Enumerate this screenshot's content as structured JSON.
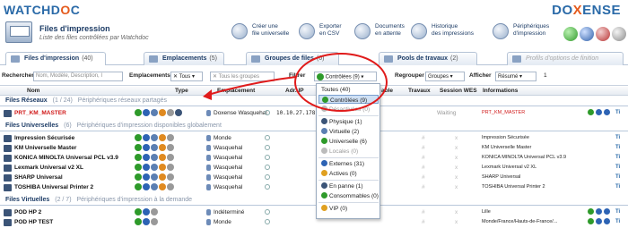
{
  "brand": {
    "left_prefix": "WATCHD",
    "left_mid": "O",
    "left_suffix": "C",
    "right_prefix": "DO",
    "right_mid": "X",
    "right_suffix": "ENSE"
  },
  "header": {
    "title": "Files d'impression",
    "subtitle": "Liste des files contrôlées par Watchdoc",
    "buttons": [
      {
        "line1": "Créer une",
        "line2": "file universelle"
      },
      {
        "line1": "Exporter",
        "line2": "en CSV"
      },
      {
        "line1": "Documents",
        "line2": "en attente"
      },
      {
        "line1": "Historique",
        "line2": "des impressions"
      },
      {
        "line1": "Périphériques",
        "line2": "d'impression"
      }
    ]
  },
  "tabs": [
    {
      "label": "Files d'impression",
      "count": "(40)"
    },
    {
      "label": "Emplacements",
      "count": "(5)"
    },
    {
      "label": "Groupes de files",
      "count": "(6)"
    },
    {
      "label": "Pools de travaux",
      "count": "(2)"
    },
    {
      "label": "Profils d'options de finition",
      "count": ""
    }
  ],
  "filterbar": {
    "rechercher_label": "Rechercher",
    "search_placeholder": "Nom, Modèle, Description, I",
    "emplacements_label": "Emplacements",
    "emplacements_value": "Tous",
    "groupe_placeholder": "Tous les groupes",
    "filtrer_label": "Filtrer",
    "filtrer_value": "Contrôlées (9)",
    "regrouper_label": "Regrouper",
    "regrouper_value": "Groupes",
    "afficher_label": "Afficher",
    "afficher_value": "Résumé",
    "count": "1"
  },
  "columns": {
    "nom": "Nom",
    "type": "Type",
    "emplacement": "Emplacement",
    "adr": "Adr. IP",
    "able": "able",
    "travaux": "Travaux",
    "session": "Session WES",
    "infos": "Informations"
  },
  "groups": [
    {
      "name": "Files Réseaux",
      "count": "(1 / 24)",
      "desc": "Périphériques réseaux partagés"
    },
    {
      "name": "Files Universelles",
      "count": "(6)",
      "desc": "Périphériques d'impression disponibles globalement"
    },
    {
      "name": "Files Virtuelles",
      "count": "(2 / 7)",
      "desc": "Périphériques d'impression à la demande"
    }
  ],
  "rows": [
    {
      "name": "PRT_KM_MASTER",
      "location": "Doxense Wasquehal",
      "ip": "10.10.27.178",
      "travaux": "",
      "session": "Waiting",
      "info": "PRT_KM_MASTER",
      "red": true
    },
    {
      "name": "Impression Sécurisée",
      "location": "Monde",
      "ip": "",
      "info": "Impression Sécurisée"
    },
    {
      "name": "KM Universelle Master",
      "location": "Wasquehal",
      "ip": "",
      "info": "KM Universelle Master"
    },
    {
      "name": "KONICA MINOLTA Universal PCL v3.9",
      "location": "Wasquehal",
      "ip": "",
      "info": "KONICA MINOLTA Universal PCL v3.9"
    },
    {
      "name": "Lexmark Universal v2 XL",
      "location": "Wasquehal",
      "ip": "",
      "info": "Lexmark Universal v2 XL"
    },
    {
      "name": "SHARP Universal",
      "location": "Wasquehal",
      "ip": "",
      "info": "SHARP Universal"
    },
    {
      "name": "TOSHIBA Universal Printer 2",
      "location": "Wasquehal",
      "ip": "",
      "info": "TOSHIBA Universal Printer 2"
    },
    {
      "name": "POD HP 2",
      "location": "Indéterminé",
      "ip": "",
      "info": "Lille"
    },
    {
      "name": "POD HP TEST",
      "location": "Monde",
      "ip": "",
      "info": "Monde/France/Hauts-de-France/..."
    }
  ],
  "dropdown": [
    {
      "label": "Toutes (40)"
    },
    {
      "label": "Contrôlées (9)"
    },
    {
      "label": "Désactivées (0)"
    },
    {
      "label": "Physique (1)"
    },
    {
      "label": "Virtuelle (2)"
    },
    {
      "label": "Universelle (6)"
    },
    {
      "label": "Locales (0)"
    },
    {
      "label": "Externes (31)"
    },
    {
      "label": "Actives (0)"
    },
    {
      "label": "En panne (1)"
    },
    {
      "label": "Consommables (0)"
    },
    {
      "label": "VIP (0)"
    }
  ],
  "row_marks": {
    "hash": "#",
    "x": "x",
    "tt": "Ti"
  },
  "colors": {
    "accent": "#2a6aa8",
    "brand_orange": "#e55b1d",
    "highlight_red": "#e01b1b"
  }
}
